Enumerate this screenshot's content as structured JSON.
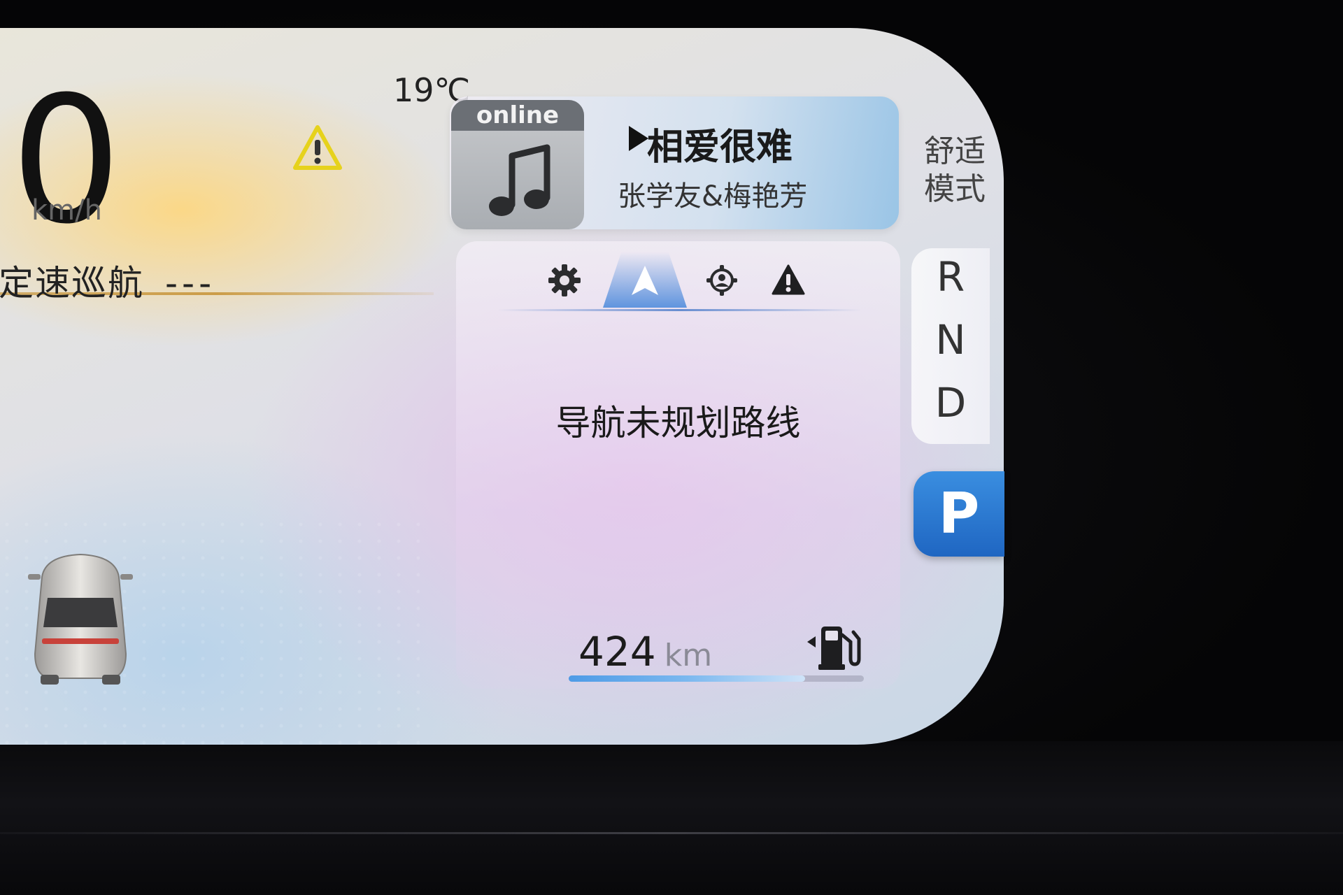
{
  "cluster": {
    "speed": "0",
    "speed_unit": "km/h",
    "temperature": "19℃",
    "cruise_label": "定速巡航",
    "cruise_value": "---",
    "drive_mode": "舒适模式"
  },
  "media": {
    "source_tag": "online",
    "song_title": "相爱很难",
    "artist": "张学友&梅艳芳"
  },
  "nav": {
    "tabs": [
      {
        "icon": "gear-icon"
      },
      {
        "icon": "navigation-arrow-icon",
        "active": true
      },
      {
        "icon": "driver-assist-icon"
      },
      {
        "icon": "warning-icon"
      }
    ],
    "message": "导航未规划路线"
  },
  "range": {
    "value": "424",
    "unit": "km",
    "fill_fraction": 0.8
  },
  "gears": {
    "options": [
      "R",
      "N",
      "D"
    ],
    "selected": "P"
  },
  "colors": {
    "accent": "#2a78d2",
    "warning": "#e6d21c"
  }
}
